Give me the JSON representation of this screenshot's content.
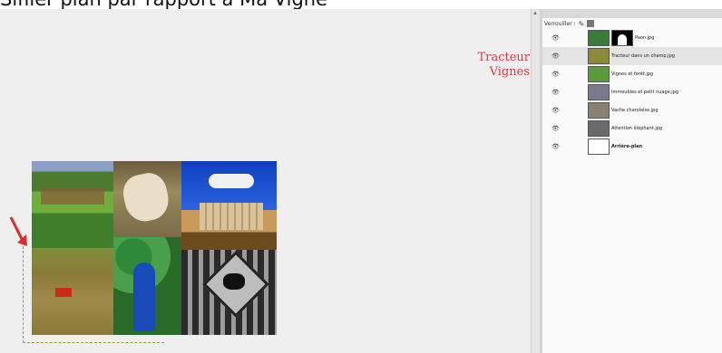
{
  "caption": "Sifiler plan par rapport à Ma Vigne",
  "canvas_texts": [
    "Tracteur",
    "Vignes"
  ],
  "layers_panel": {
    "toolbar_label": "Verrouiller :",
    "layers": [
      {
        "name": "Paon.jpg",
        "selected": false,
        "has_mask": true
      },
      {
        "name": "Tracteur dans un champ.jpg",
        "selected": true,
        "has_mask": false
      },
      {
        "name": "Vignes et forêt.jpg",
        "selected": false,
        "has_mask": false
      },
      {
        "name": "Immeubles et petit nuage.jpg",
        "selected": false,
        "has_mask": false
      },
      {
        "name": "Vache charolaise.jpg",
        "selected": false,
        "has_mask": false
      },
      {
        "name": "Attention éléphant.jpg",
        "selected": false,
        "has_mask": false
      },
      {
        "name": "Arrière-plan",
        "selected": false,
        "has_mask": false
      }
    ]
  },
  "colors": {
    "red_text": "#d83a3a",
    "canvas_bg": "#efefef"
  }
}
